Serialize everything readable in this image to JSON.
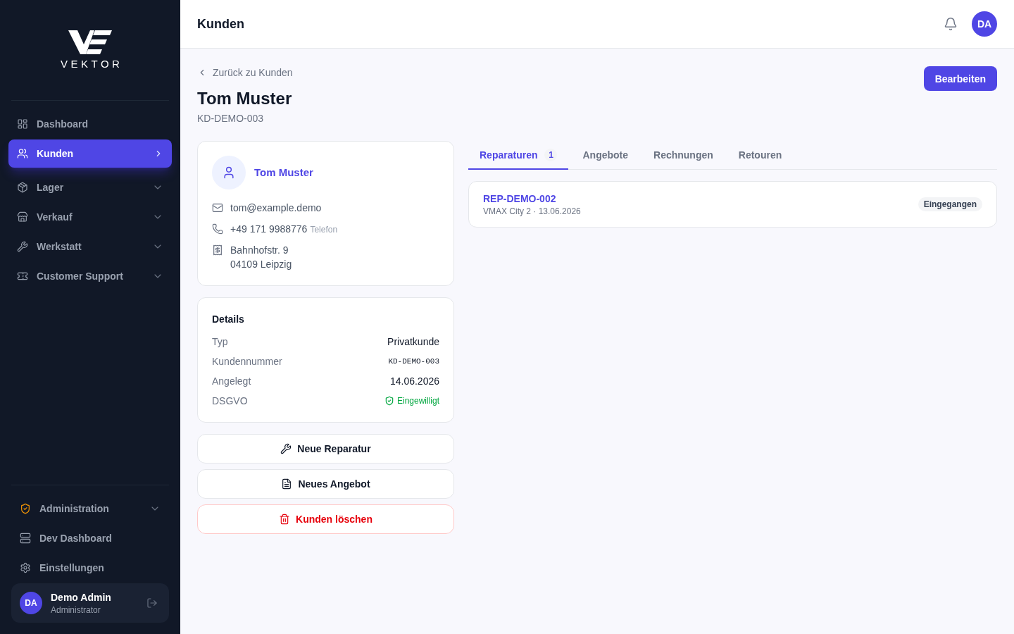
{
  "sidebar": {
    "logo": {
      "wordmark": "VEKTOR"
    },
    "nav": [
      {
        "label": "Dashboard",
        "kind": "link",
        "selected": false
      },
      {
        "label": "Kunden",
        "kind": "link",
        "selected": true
      },
      {
        "label": "Lager",
        "kind": "group",
        "selected": false,
        "expanded": false
      },
      {
        "label": "Verkauf",
        "kind": "group",
        "selected": false,
        "expanded": false
      },
      {
        "label": "Werkstatt",
        "kind": "group",
        "selected": false,
        "expanded": false
      },
      {
        "label": "Customer Support",
        "kind": "group",
        "selected": false,
        "expanded": false
      }
    ],
    "bottom_nav": [
      {
        "label": "Administration",
        "kind": "group",
        "selected": false,
        "expanded": false
      },
      {
        "label": "Dev Dashboard",
        "kind": "link",
        "selected": false
      },
      {
        "label": "Einstellungen",
        "kind": "link",
        "selected": false
      }
    ],
    "user": {
      "initials": "DA",
      "name": "Demo Admin",
      "role": "Administrator"
    }
  },
  "header": {
    "title": "Kunden",
    "avatar_initials": "DA"
  },
  "page": {
    "back_link": "Zurück zu Kunden",
    "title": "Tom Muster",
    "subtitle": "KD-DEMO-003",
    "edit_button": "Bearbeiten"
  },
  "contact_card": {
    "name": "Tom Muster",
    "contacts": [
      {
        "kind": "email",
        "value": "tom@example.demo"
      },
      {
        "kind": "phone",
        "value": "+49 171 9988776",
        "note": "Telefon"
      },
      {
        "kind": "address",
        "lines": [
          "Bahnhofstr. 9",
          "04109 Leipzig"
        ]
      }
    ]
  },
  "details": {
    "title": "Details",
    "rows": [
      {
        "label": "Typ",
        "value": "Privatkunde",
        "kind": "text"
      },
      {
        "label": "Kundennummer",
        "value": "KD-DEMO-003",
        "kind": "code"
      },
      {
        "label": "Angelegt",
        "value": "14.06.2026",
        "kind": "text"
      },
      {
        "label": "DSGVO",
        "value": "Eingewilligt",
        "kind": "consent"
      }
    ]
  },
  "actions": [
    {
      "label": "Neue Reparatur",
      "kind": "default"
    },
    {
      "label": "Neues Angebot",
      "kind": "default"
    },
    {
      "label": "Kunden löschen",
      "kind": "danger"
    }
  ],
  "tabs": [
    {
      "label": "Reparaturen",
      "count": "1",
      "selected": true
    },
    {
      "label": "Angebote",
      "selected": false
    },
    {
      "label": "Rechnungen",
      "selected": false
    },
    {
      "label": "Retouren",
      "selected": false
    }
  ],
  "repairs": [
    {
      "id": "REP-DEMO-002",
      "detail": "VMAX City 2 · 13.06.2026",
      "status": "Eingegangen"
    }
  ]
}
